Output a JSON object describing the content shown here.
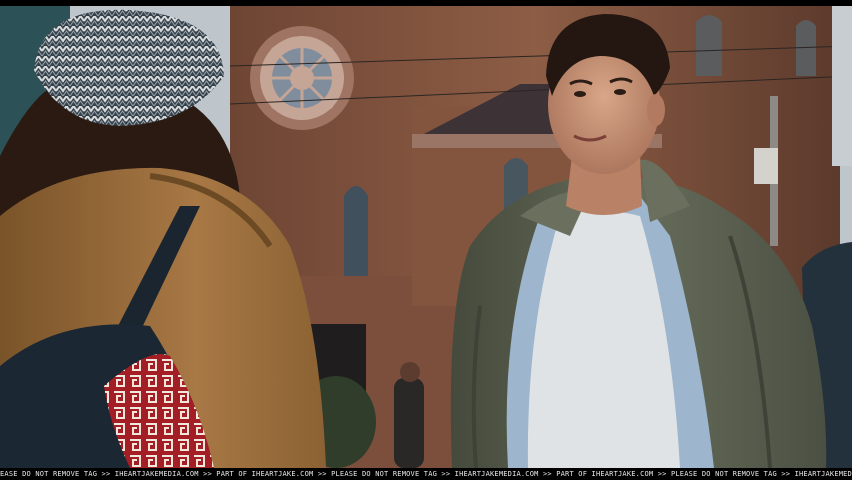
{
  "watermark": {
    "text": "EASE DO NOT REMOVE TAG >> IHEARTJAKEMEDIA.COM >> PART OF IHEARTJAKE.COM >> PLEASE DO NOT REMOVE TAG >> IHEARTJAKEMEDIA.COM >> PART OF IHEARTJAKE.COM >> PLEASE DO NOT REMOVE TAG >> IHEARTJAKEMEDIA"
  },
  "colors": {
    "brick": "#8a5a44",
    "sky": "#c9cfd3",
    "coat": "#a5733e",
    "jacket": "#5e6352",
    "shirt": "#d9dde0",
    "denim": "#9cb6cf"
  }
}
